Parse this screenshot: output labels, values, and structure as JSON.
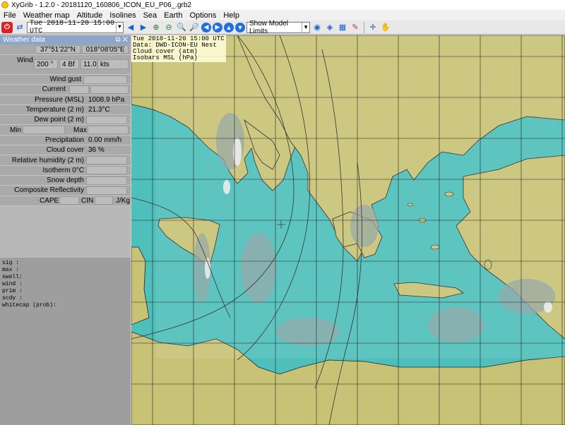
{
  "window": {
    "title": "XyGrib - 1.2.0 - 20181120_160806_ICON_EU_P06_.grb2"
  },
  "menu": [
    "File",
    "Weather map",
    "Altitude",
    "Isolines",
    "Sea",
    "Earth",
    "Options",
    "Help"
  ],
  "toolbar": {
    "date_value": "Tue 2018-11-20 15:00 UTC",
    "model_limits": "Show Model Limits"
  },
  "panel": {
    "title": "Weather data",
    "lat": "37°51'22\"N",
    "lon": "018°08'05\"E",
    "wind_label": "Wind",
    "wind_dir": "200 °",
    "wind_bf": "4 Bf",
    "wind_speed": "11.0",
    "wind_unit": "kts",
    "wind_gust_label": "Wind gust",
    "current_label": "Current",
    "pressure_label": "Pressure (MSL)",
    "pressure_value": "1008.9 hPa",
    "temp_label": "Temperature (2 m)",
    "temp_value": "21.3°C",
    "dew_label": "Dew point (2 m)",
    "min_label": "Min",
    "max_label": "Max",
    "precip_label": "Precipitation",
    "precip_value": "0.00 mm/h",
    "cloud_label": "Cloud cover",
    "cloud_value": "36 %",
    "rh_label": "Relative humidity (2 m)",
    "iso_label": "Isotherm 0°C",
    "snow_label": "Snow depth",
    "refl_label": "Composite Reflectivity",
    "cape_label": "CAPE",
    "cin_label": "CIN",
    "jkg_label": "J/Kg"
  },
  "log_lines": [
    "sig   :",
    "max   :",
    "swell:",
    "wind  :",
    "prim  :",
    "scdy  :",
    "whitecap (prob):"
  ],
  "map_info": {
    "line1": "Tue 2018-11-20 15:00 UTC",
    "line2": "Data: DWD-ICON-EU Nest",
    "line3": "Cloud cover (atm)",
    "line4": "Isobars MSL (hPa)"
  },
  "colors": {
    "sea": "#4fbfbb",
    "land": "#c8c276",
    "panel_header": "#8ca5c8"
  }
}
